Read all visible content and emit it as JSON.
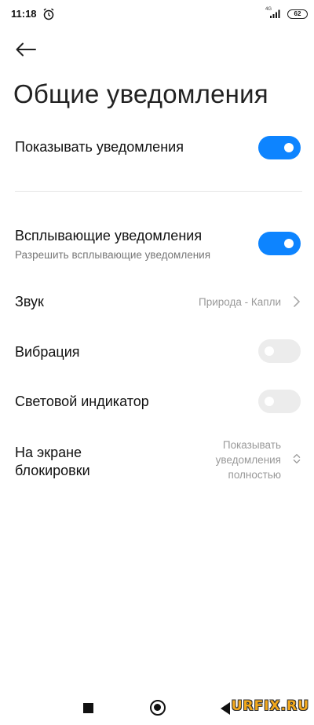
{
  "status_bar": {
    "time": "11:18",
    "network": "4G",
    "battery": "62"
  },
  "page": {
    "title": "Общие уведомления"
  },
  "settings": {
    "show_notifications": {
      "label": "Показывать уведомления",
      "enabled": true
    },
    "popup_notifications": {
      "label": "Всплывающие уведомления",
      "sublabel": "Разрешить всплывающие уведомления",
      "enabled": true
    },
    "sound": {
      "label": "Звук",
      "value": "Природа - Капли"
    },
    "vibration": {
      "label": "Вибрация",
      "enabled": false
    },
    "led_indicator": {
      "label": "Световой индикатор",
      "enabled": false
    },
    "lock_screen": {
      "label_line1": "На экране",
      "label_line2": "блокировки",
      "value_line1": "Показывать",
      "value_line2": "уведомления",
      "value_line3": "полностью"
    }
  },
  "watermark": "URFIX.RU",
  "colors": {
    "accent": "#0d84ff",
    "toggle_off": "#ececec",
    "secondary_text": "#999999"
  }
}
